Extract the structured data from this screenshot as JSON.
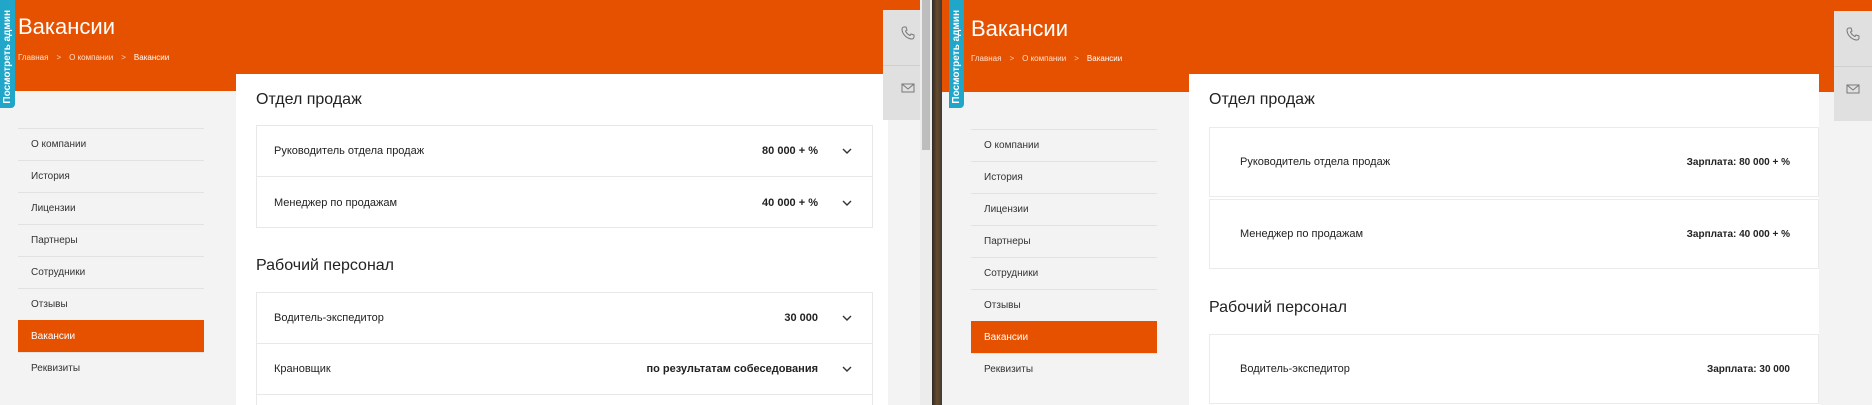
{
  "page": {
    "title": "Вакансии",
    "admin_tab_label": "Посмотреть админ"
  },
  "breadcrumb": {
    "home": "Главная",
    "about": "О компании",
    "current": "Вакансии",
    "separator": ">"
  },
  "sidebar": {
    "items": [
      {
        "label": "О компании"
      },
      {
        "label": "История"
      },
      {
        "label": "Лицензии"
      },
      {
        "label": "Партнеры"
      },
      {
        "label": "Сотрудники"
      },
      {
        "label": "Отзывы"
      },
      {
        "label": "Вакансии",
        "active": true
      },
      {
        "label": "Реквизиты"
      }
    ]
  },
  "side_panel": {
    "icons": [
      "phone-icon",
      "mail-icon"
    ]
  },
  "left_view": {
    "sections": [
      {
        "title": "Отдел продаж",
        "vacancies": [
          {
            "name": "Руководитель отдела продаж",
            "salary": "80 000 + %"
          },
          {
            "name": "Менеджер по продажам",
            "salary": "40 000 + %"
          }
        ]
      },
      {
        "title": "Рабочий персонал",
        "vacancies": [
          {
            "name": "Водитель-экспедитор",
            "salary": "30 000"
          },
          {
            "name": "Крановщик",
            "salary": "по результатам собеседования"
          }
        ]
      }
    ]
  },
  "right_view": {
    "sections": [
      {
        "title": "Отдел продаж",
        "vacancies": [
          {
            "name": "Руководитель отдела продаж",
            "salary": "Зарплата: 80 000 + %"
          },
          {
            "name": "Менеджер по продажам",
            "salary": "Зарплата: 40 000 + %"
          }
        ]
      },
      {
        "title": "Рабочий персонал",
        "vacancies": [
          {
            "name": "Водитель-экспедитор",
            "salary": "Зарплата: 30 000"
          }
        ]
      }
    ]
  },
  "colors": {
    "accent": "#e65100",
    "admin_tab": "#1fa6c9",
    "background": "#f3f3f3"
  }
}
